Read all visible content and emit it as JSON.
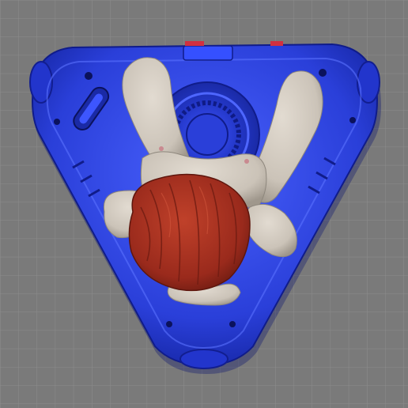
{
  "viewport": {
    "background_color": "#7a7a7a",
    "grid_color": "#8c8c8c"
  },
  "model": {
    "base_color": "#2a3fd9",
    "base_highlight": "#4a62ff",
    "base_shadow": "#1424a0",
    "accent_color": "#d23040",
    "figure_skin_color": "#cbc3b8",
    "figure_skin_shadow": "#9f978c",
    "hair_color": "#9a2a1c",
    "hair_highlight": "#c0412a"
  }
}
